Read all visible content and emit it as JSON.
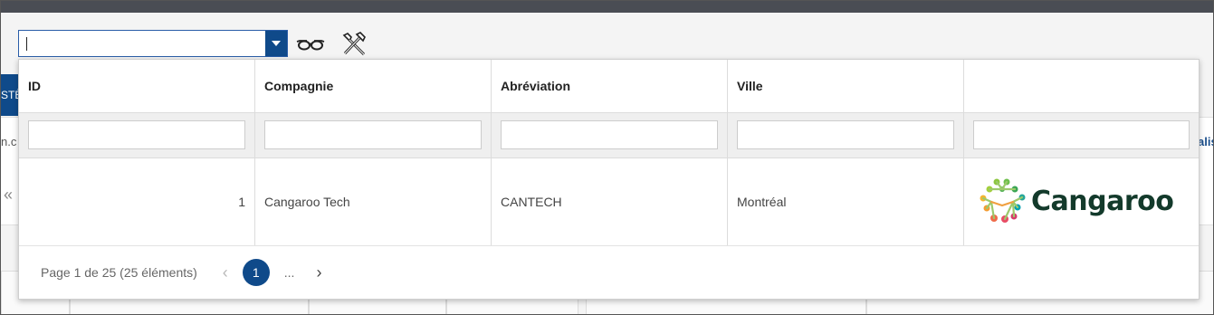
{
  "combo": {
    "value": ""
  },
  "grid": {
    "headers": [
      "ID",
      "Compagnie",
      "Abréviation",
      "Ville",
      ""
    ],
    "rows": [
      {
        "id": "1",
        "company": "Cangaroo Tech",
        "abbreviation": "CANTECH",
        "city": "Montréal",
        "logo_text": "Cangaroo"
      }
    ]
  },
  "pager": {
    "info": "Page 1 de 25 (25 éléments)",
    "current": "1",
    "ellipsis": "...",
    "prev": "‹",
    "next": "›"
  },
  "background": {
    "left_tab": "STÈ",
    "left_text": "n.c",
    "right_text": "alis",
    "chevron": "«"
  },
  "icons": {
    "view": "glasses-icon",
    "tools": "tools-icon",
    "dropdown": "caret-down-icon",
    "logo": "cangaroo-logo"
  },
  "colors": {
    "accent": "#0f4a8a",
    "topbar": "#4a4d54",
    "logo_text": "#133a2b"
  }
}
